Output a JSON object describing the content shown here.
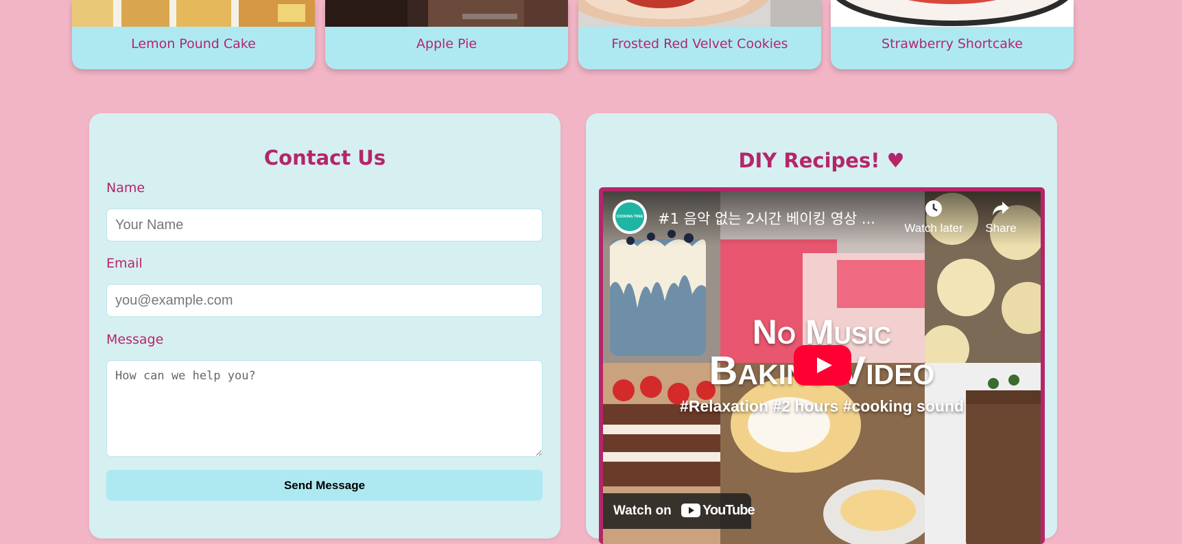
{
  "recipe_cards": [
    {
      "label": "Lemon Pound Cake"
    },
    {
      "label": "Apple Pie"
    },
    {
      "label": "Frosted Red Velvet Cookies"
    },
    {
      "label": "Strawberry Shortcake"
    }
  ],
  "contact": {
    "title": "Contact Us",
    "name_label": "Name",
    "name_placeholder": "Your Name",
    "email_label": "Email",
    "email_placeholder": "you@example.com",
    "message_label": "Message",
    "message_placeholder": "How can we help you?",
    "send_label": "Send Message"
  },
  "diy": {
    "title": "DIY Recipes! ♥",
    "video": {
      "channel_logo_text": "COOKING TREE",
      "title": "#1 음악 없는 2시간 베이킹 영상 ...",
      "watch_later_label": "Watch later",
      "share_label": "Share",
      "overlay_line1": "No Music",
      "overlay_line2": "Baking Video",
      "overlay_tags": "#Relaxation #2 hours #cooking sound",
      "watch_on_label": "Watch on",
      "youtube_label": "YouTube"
    }
  },
  "colors": {
    "background": "#f2b5c6",
    "accent": "#b5256a",
    "card": "#aee9f1",
    "panel": "#d6eff1",
    "youtube_red": "#ff0033"
  }
}
